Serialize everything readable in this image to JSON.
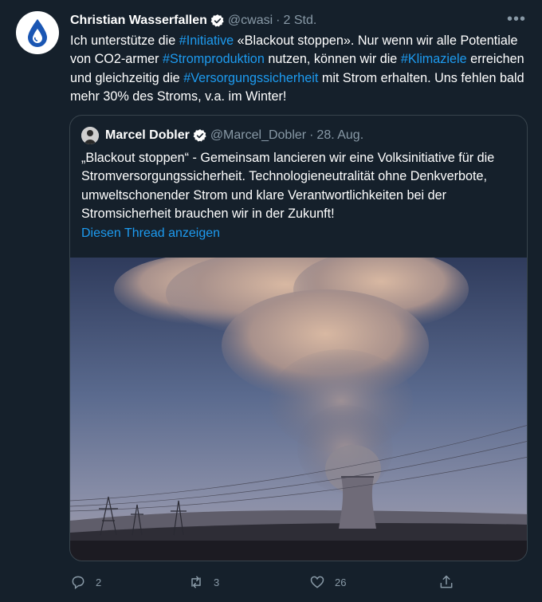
{
  "author": {
    "name": "Christian Wasserfallen",
    "handle": "@cwasi",
    "separator": "·",
    "time": "2 Std."
  },
  "tweet": {
    "segments": [
      {
        "text": "Ich unterstütze die ",
        "tag": false
      },
      {
        "text": "#Initiative",
        "tag": true
      },
      {
        "text": " «Blackout stoppen». Nur wenn wir alle Potentiale von CO2-armer ",
        "tag": false
      },
      {
        "text": "#Stromproduktion",
        "tag": true
      },
      {
        "text": " nutzen, können wir die ",
        "tag": false
      },
      {
        "text": "#Klimaziele",
        "tag": true
      },
      {
        "text": " erreichen und gleichzeitig die ",
        "tag": false
      },
      {
        "text": "#Versorgungssicherheit",
        "tag": true
      },
      {
        "text": " mit Strom erhalten. Uns fehlen bald mehr 30% des Stroms, v.a. im Winter!",
        "tag": false
      }
    ]
  },
  "quote": {
    "name": "Marcel Dobler",
    "handle": "@Marcel_Dobler",
    "separator": "·",
    "time": "28. Aug.",
    "text": "„Blackout stoppen“ - Gemeinsam lancieren wir eine Volksinitiative für die Stromversorgungssicherheit. Technologieneutralität ohne Denkverbote, umweltschonender Strom und klare Verantwortlichkeiten bei der Stromsicherheit brauchen wir in der Zukunft!",
    "thread_link": "Diesen Thread anzeigen"
  },
  "actions": {
    "replies": "2",
    "retweets": "3",
    "likes": "26"
  },
  "icons": {
    "avatar": "water-drop-logo",
    "verified": "verified-badge-icon",
    "more": "more-icon",
    "reply": "reply-icon",
    "retweet": "retweet-icon",
    "like": "like-icon",
    "share": "share-icon"
  },
  "colors": {
    "background": "#15202b",
    "link": "#1d9bf0",
    "muted": "#8899a6",
    "border": "#38444d"
  }
}
